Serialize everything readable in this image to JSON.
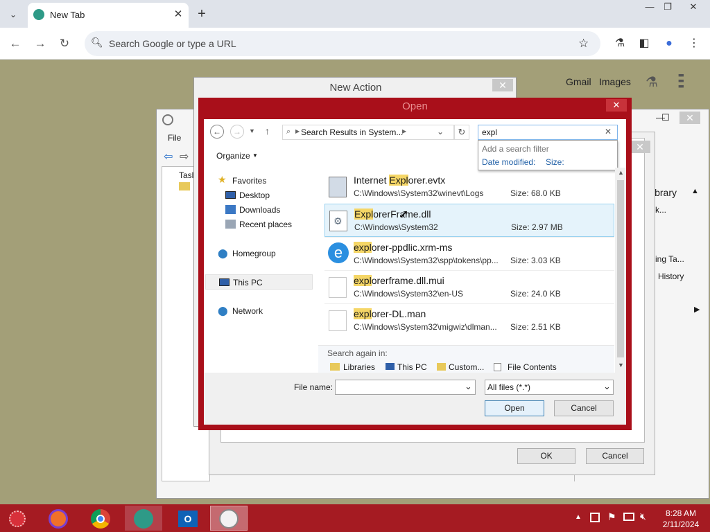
{
  "browser": {
    "tab_title": "New Tab",
    "tab_close": "✕",
    "tab_search_icon": "chevron-down-icon",
    "new_tab": "+",
    "minimize": "—",
    "restore": "❐",
    "close": "✕",
    "back": "←",
    "forward": "→",
    "reload": "↻",
    "omnibox_placeholder": "Search Google or type a URL",
    "star": "☆",
    "lab": "⚗",
    "sidepanel": "◧",
    "profile": "●",
    "menu": "⋮"
  },
  "ntp": {
    "gmail": "Gmail",
    "images": "Images",
    "apps": "⋮⋮⋮"
  },
  "new_action": {
    "title": "New Action",
    "ok": "OK",
    "cancel": "Cancel"
  },
  "bg_window": {
    "menu_file": "File",
    "tree_item": "Tasl",
    "right_panel": [
      "ibrary",
      "k...",
      "ing Ta...",
      "History"
    ]
  },
  "open_dialog": {
    "title": "Open",
    "breadcrumb": "Search Results in System...",
    "search_value": "expl",
    "filter_hint": "Add a search filter",
    "filter_date": "Date modified:",
    "filter_size": "Size:",
    "organize": "Organize",
    "nav": {
      "favorites": "Favorites",
      "desktop": "Desktop",
      "downloads": "Downloads",
      "recent": "Recent places",
      "homegroup": "Homegroup",
      "thispc": "This PC",
      "network": "Network"
    },
    "files": [
      {
        "pre": "Internet ",
        "hl": "Expl",
        "post": "orer.evtx",
        "path": "C:\\Windows\\System32\\winevt\\Logs",
        "size": "Size: 68.0 KB"
      },
      {
        "pre": "",
        "hl": "Expl",
        "post": "orerFrame.dll",
        "path": "C:\\Windows\\System32",
        "size": "Size: 2.97 MB"
      },
      {
        "pre": "",
        "hl": "expl",
        "post": "orer-ppdlic.xrm-ms",
        "path": "C:\\Windows\\System32\\spp\\tokens\\pp...",
        "size": "Size: 3.03 KB"
      },
      {
        "pre": "",
        "hl": "expl",
        "post": "orerframe.dll.mui",
        "path": "C:\\Windows\\System32\\en-US",
        "size": "Size: 24.0 KB"
      },
      {
        "pre": "",
        "hl": "expl",
        "post": "orer-DL.man",
        "path": "C:\\Windows\\System32\\migwiz\\dlman...",
        "size": "Size: 2.51 KB"
      }
    ],
    "search_again": "Search again in:",
    "search_locations": [
      "Libraries",
      "This PC",
      "Custom...",
      "File Contents"
    ],
    "file_name_label": "File name:",
    "file_name_value": "",
    "file_type": "All files (*.*)",
    "open_btn": "Open",
    "cancel_btn": "Cancel"
  },
  "taskbar": {
    "time": "8:28 AM",
    "date": "2/11/2024"
  }
}
